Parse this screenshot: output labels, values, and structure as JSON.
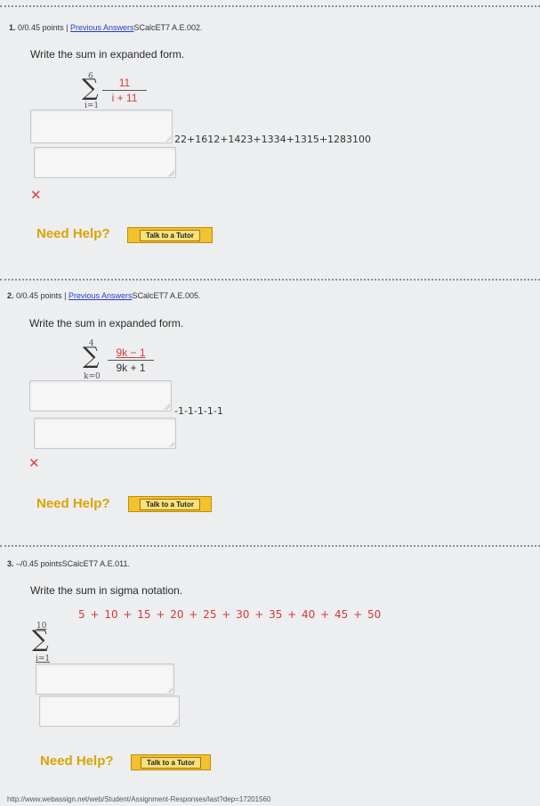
{
  "q1": {
    "number": "1.",
    "points": "0/0.45 points",
    "separator": "|",
    "previous_answers": "Previous Answers",
    "code": "SCalcET7 A.E.002.",
    "prompt": "Write the sum in expanded form.",
    "sigma_upper": "6",
    "sigma_lower": "i=1",
    "fraction_numerator": "11",
    "fraction_denominator": "i + 11",
    "submitted_answer": "22+1612+1423+1334+1315+1283100",
    "result": "✕",
    "need_help": "Need Help?",
    "tutor_button": "Talk to a Tutor"
  },
  "q2": {
    "number": "2.",
    "points": "0/0.45 points",
    "separator": "|",
    "previous_answers": "Previous Answers",
    "code": "SCalcET7 A.E.005.",
    "prompt": "Write the sum in expanded form.",
    "sigma_upper": "4",
    "sigma_lower": "k=0",
    "fraction_numerator": "9k − 1",
    "fraction_denominator": "9k + 1",
    "submitted_answer": "-1-1-1-1-1",
    "result": "✕",
    "need_help": "Need Help?",
    "tutor_button": "Talk to a Tutor"
  },
  "q3": {
    "number": "3.",
    "points": "–/0.45 points",
    "code": "SCalcET7 A.E.011.",
    "prompt": "Write the sum in sigma notation.",
    "series": "5 + 10 + 15 + 20 + 25 + 30 + 35 + 40 + 45 + 50",
    "sigma_upper": "10",
    "sigma_lower": "i=1",
    "need_help": "Need Help?",
    "tutor_button": "Talk to a Tutor"
  },
  "status_url": "http://www.webassign.net/web/Student/Assignment-Responses/last?dep=17201560",
  "colors": {
    "link": "#2a3fc4",
    "wrong": "#e0403a",
    "help": "#d9a400",
    "tutor": "#f2c230",
    "series": "#d33b3b"
  }
}
